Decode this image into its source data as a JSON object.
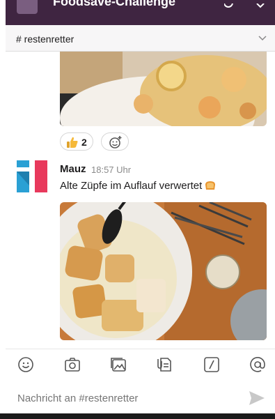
{
  "header": {
    "workspace_title": "Foodsave-Challenge",
    "channel": "# restenretter"
  },
  "reactions": [
    {
      "icon": "thumbs-up-icon",
      "count": "2"
    },
    {
      "icon": "add-reaction-icon"
    }
  ],
  "message": {
    "author": "Mauz",
    "time": "18:57 Uhr",
    "text": "Alte Züpfe im Auflauf verwertet"
  },
  "toolbar": {
    "icons": [
      "emoji-icon",
      "camera-icon",
      "image-icon",
      "file-icon",
      "slash-command-icon",
      "mention-icon"
    ]
  },
  "composer": {
    "placeholder": "Nachricht an #restenretter"
  },
  "colors": {
    "header_bg": "#3f2541",
    "avatar_blue": "#2aa0d4",
    "avatar_red": "#e8395c"
  }
}
